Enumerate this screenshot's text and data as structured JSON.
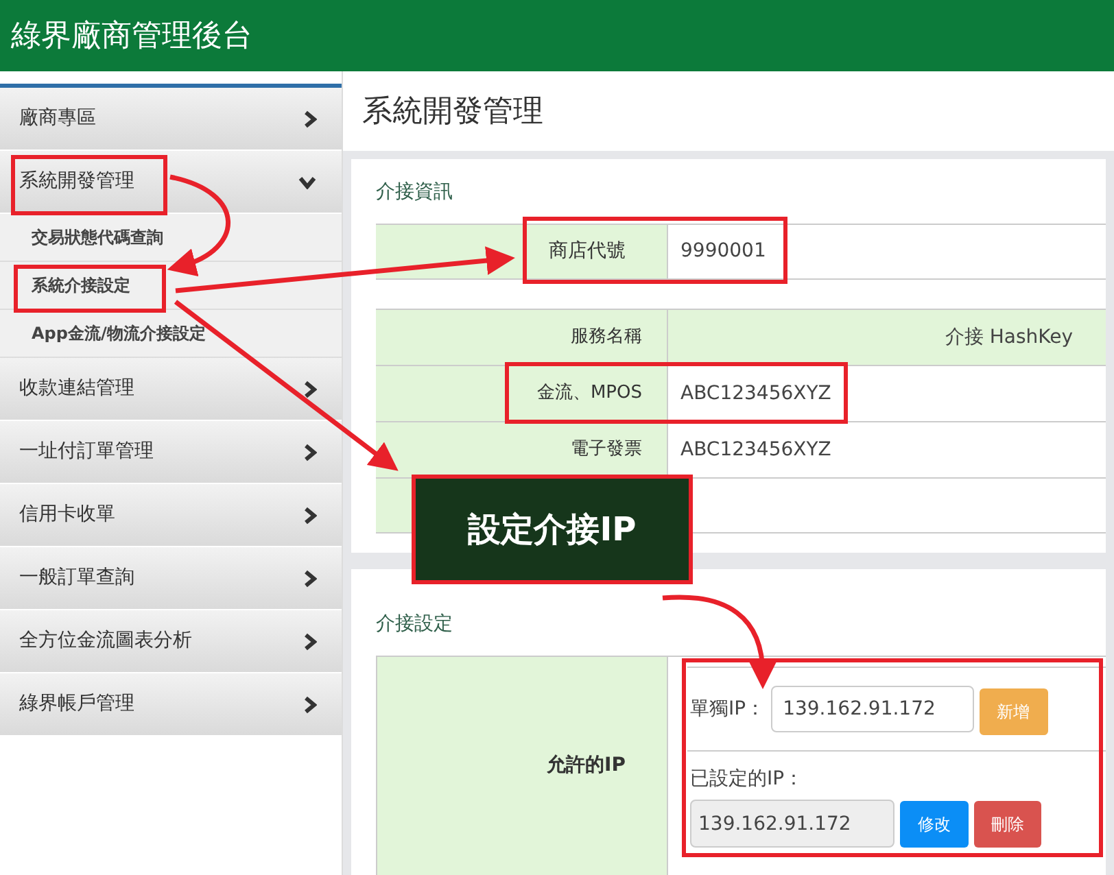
{
  "header": {
    "title": "綠界廠商管理後台"
  },
  "sidebar": {
    "items": [
      {
        "label": "廠商專區",
        "expanded": false
      },
      {
        "label": "系統開發管理",
        "expanded": true,
        "children": [
          {
            "label": "交易狀態代碼查詢"
          },
          {
            "label": "系統介接設定"
          },
          {
            "label": "App金流/物流介接設定"
          }
        ]
      },
      {
        "label": "收款連結管理",
        "expanded": false
      },
      {
        "label": "一址付訂單管理",
        "expanded": false
      },
      {
        "label": "信用卡收單",
        "expanded": false
      },
      {
        "label": "一般訂單查詢",
        "expanded": false
      },
      {
        "label": "全方位金流圖表分析",
        "expanded": false
      },
      {
        "label": "綠界帳戶管理",
        "expanded": false
      }
    ]
  },
  "page_title": "系統開發管理",
  "integration_info": {
    "heading": "介接資訊",
    "merchant": {
      "label": "商店代號",
      "value": "9990001"
    },
    "hashkey_table": {
      "columns": [
        "服務名稱",
        "介接 HashKey"
      ],
      "rows": [
        {
          "service": "金流、MPOS",
          "key": "ABC123456XYZ"
        },
        {
          "service": "電子發票",
          "key": "ABC123456XYZ"
        }
      ]
    }
  },
  "integration_settings": {
    "heading": "介接設定",
    "label": "允許的IP",
    "single_ip_label": "單獨IP：",
    "single_ip_value": "139.162.91.172",
    "add_button": "新增",
    "configured_label": "已設定的IP：",
    "configured_ip": {
      "value": "139.162.91.172",
      "disabled": true
    },
    "edit_button": "修改",
    "delete_button": "刪除"
  },
  "annotation": {
    "callout": "設定介接IP"
  }
}
